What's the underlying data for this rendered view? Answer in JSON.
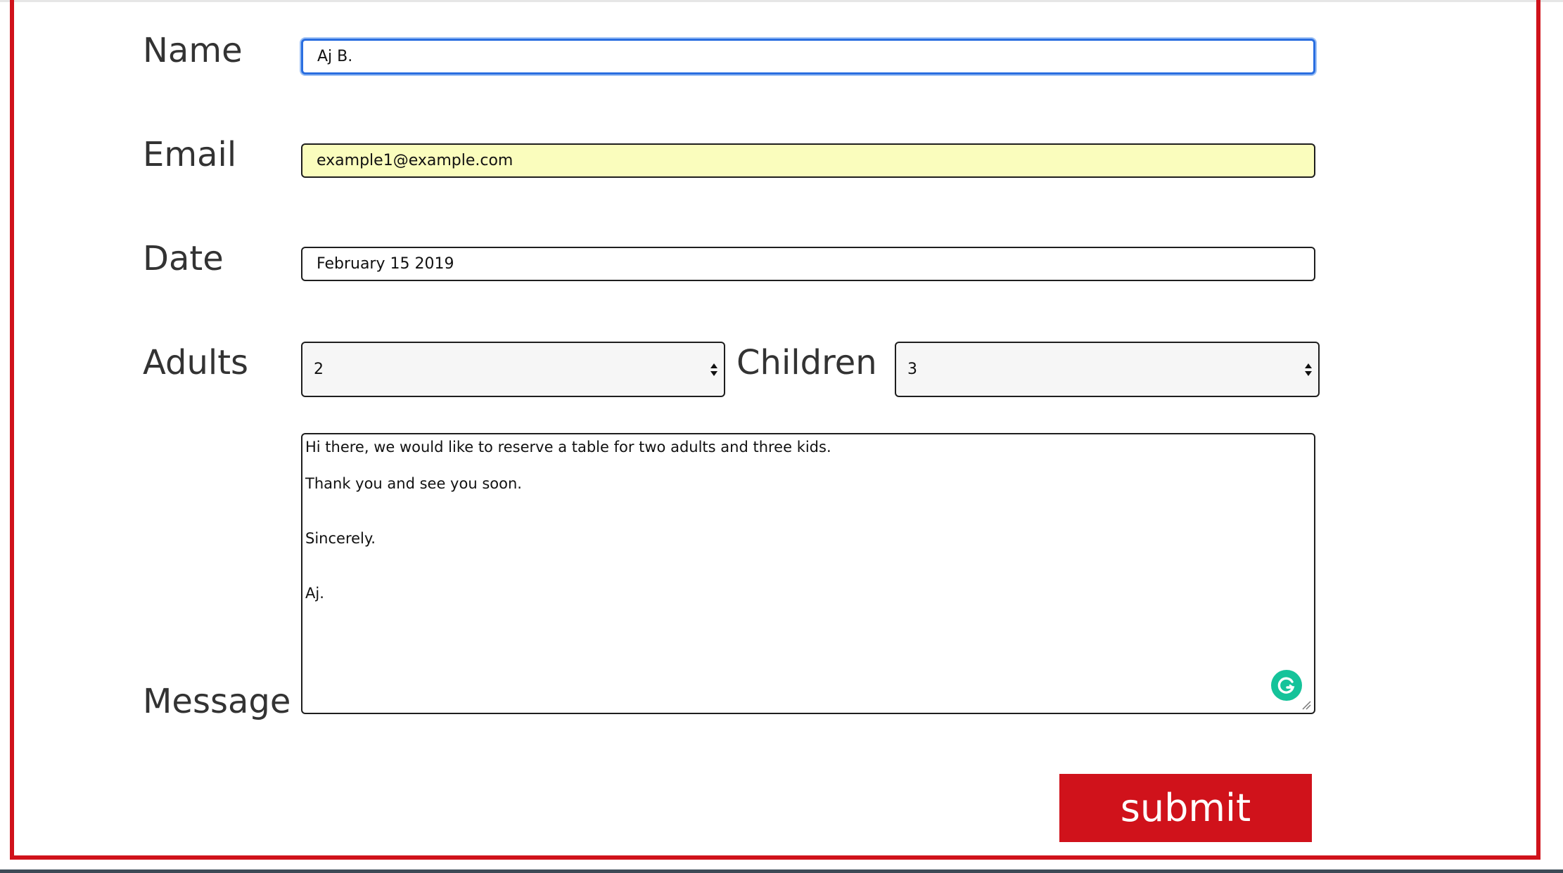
{
  "form": {
    "name": {
      "label": "Name",
      "value": "Aj B."
    },
    "email": {
      "label": "Email",
      "value": "example1@example.com"
    },
    "date": {
      "label": "Date",
      "value": "February 15 2019"
    },
    "adults": {
      "label": "Adults",
      "selected": "2"
    },
    "children": {
      "label": "Children",
      "selected": "3"
    },
    "message": {
      "label": "Message",
      "lines": [
        "Hi there, we would like to reserve a table for two adults and three kids.",
        "Thank you and see you soon.",
        "Sincerely.",
        "Aj."
      ]
    },
    "submit_label": "submit"
  },
  "icons": {
    "grammarly": "grammarly-icon",
    "select_arrows": "updown-arrows-icon",
    "resize": "resize-grip-icon"
  },
  "colors": {
    "accent": "#d0121b",
    "focus_ring": "#2a6ee0",
    "autofill": "#fafdbd",
    "grammarly": "#15c39a"
  }
}
